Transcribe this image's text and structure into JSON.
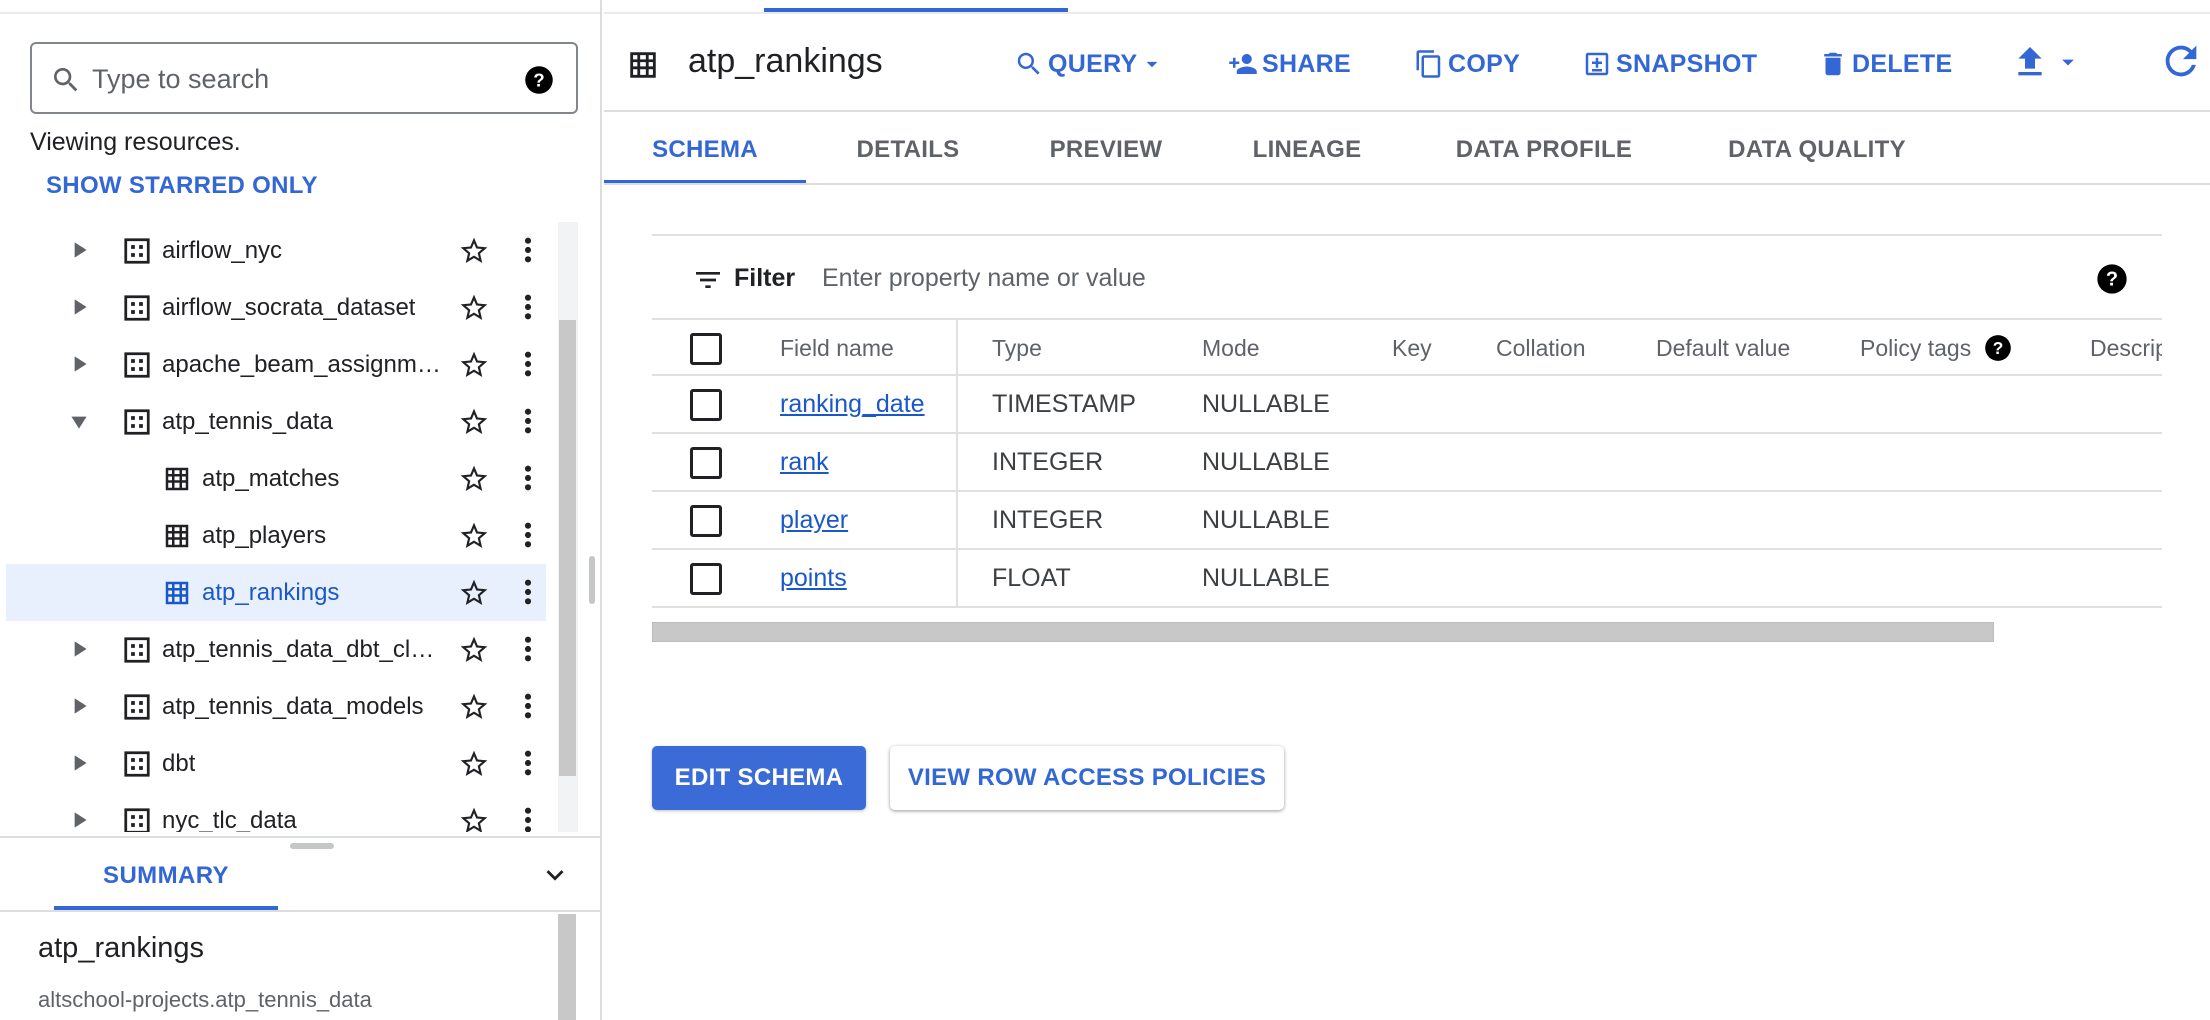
{
  "explorer": {
    "search_placeholder": "Type to search",
    "viewing_text": "Viewing resources.",
    "show_starred_label": "SHOW STARRED ONLY",
    "items": [
      {
        "label": "airflow_nyc",
        "type": "dataset",
        "expanded": false
      },
      {
        "label": "airflow_socrata_dataset",
        "type": "dataset",
        "expanded": false
      },
      {
        "label": "apache_beam_assignme…",
        "type": "dataset",
        "expanded": false
      },
      {
        "label": "atp_tennis_data",
        "type": "dataset",
        "expanded": true
      },
      {
        "label": "atp_matches",
        "type": "table"
      },
      {
        "label": "atp_players",
        "type": "table"
      },
      {
        "label": "atp_rankings",
        "type": "table",
        "selected": true
      },
      {
        "label": "atp_tennis_data_dbt_clo…",
        "type": "dataset",
        "expanded": false
      },
      {
        "label": "atp_tennis_data_models",
        "type": "dataset",
        "expanded": false
      },
      {
        "label": "dbt",
        "type": "dataset",
        "expanded": false
      },
      {
        "label": "nyc_tlc_data",
        "type": "dataset",
        "expanded": false
      }
    ]
  },
  "summary": {
    "tab_label": "SUMMARY",
    "title": "atp_rankings",
    "path": "altschool-projects.atp_tennis_data"
  },
  "header": {
    "title": "atp_rankings",
    "actions": {
      "query": "QUERY",
      "share": "SHARE",
      "copy": "COPY",
      "snapshot": "SNAPSHOT",
      "delete": "DELETE"
    }
  },
  "tabs": [
    "SCHEMA",
    "DETAILS",
    "PREVIEW",
    "LINEAGE",
    "DATA PROFILE",
    "DATA QUALITY"
  ],
  "schema": {
    "filter_label": "Filter",
    "filter_placeholder": "Enter property name or value",
    "columns": [
      "Field name",
      "Type",
      "Mode",
      "Key",
      "Collation",
      "Default value",
      "Policy tags",
      "Descrip"
    ],
    "rows": [
      {
        "name": "ranking_date",
        "type": "TIMESTAMP",
        "mode": "NULLABLE"
      },
      {
        "name": "rank",
        "type": "INTEGER",
        "mode": "NULLABLE"
      },
      {
        "name": "player",
        "type": "INTEGER",
        "mode": "NULLABLE"
      },
      {
        "name": "points",
        "type": "FLOAT",
        "mode": "NULLABLE"
      }
    ],
    "edit_schema_label": "EDIT SCHEMA",
    "row_policies_label": "VIEW ROW ACCESS POLICIES"
  },
  "colors": {
    "accent": "#3367d6",
    "link": "#1a57c9",
    "selected_bg": "#e8f0fe",
    "primary_button": "#3b6bd6"
  }
}
